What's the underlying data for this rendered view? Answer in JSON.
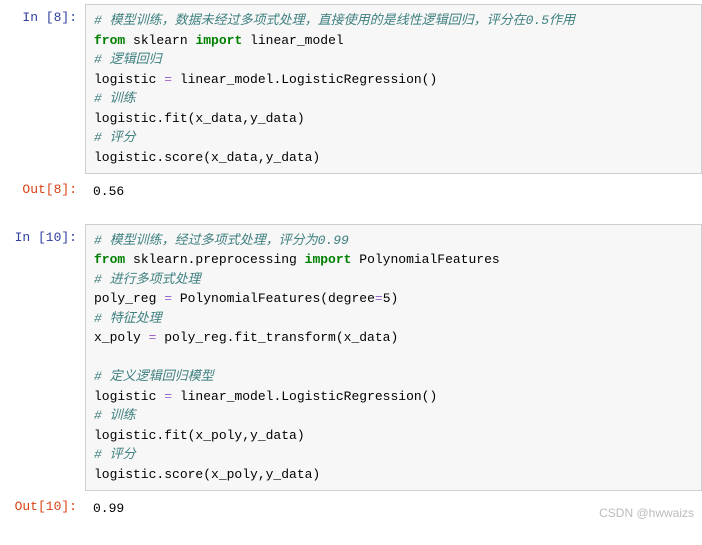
{
  "cells": [
    {
      "prompt_label": "In  [8]:",
      "type": "in",
      "lines": [
        [
          {
            "cls": "c-comment",
            "t": "# 模型训练，数据未经过多项式处理，直接使用的是线性逻辑回归，评分在0.5作用"
          }
        ],
        [
          {
            "cls": "c-keyword",
            "t": "from"
          },
          {
            "cls": "",
            "t": " sklearn "
          },
          {
            "cls": "c-keyword",
            "t": "import"
          },
          {
            "cls": "",
            "t": " linear_model"
          }
        ],
        [
          {
            "cls": "c-comment",
            "t": "# 逻辑回归"
          }
        ],
        [
          {
            "cls": "",
            "t": "logistic "
          },
          {
            "cls": "c-operator",
            "t": "="
          },
          {
            "cls": "",
            "t": " linear_model.LogisticRegression()"
          }
        ],
        [
          {
            "cls": "c-comment",
            "t": "# 训练"
          }
        ],
        [
          {
            "cls": "",
            "t": "logistic.fit(x_data,y_data)"
          }
        ],
        [
          {
            "cls": "c-comment",
            "t": "# 评分"
          }
        ],
        [
          {
            "cls": "",
            "t": "logistic.score(x_data,y_data)"
          }
        ]
      ]
    },
    {
      "prompt_label": "Out[8]:",
      "type": "out",
      "output": "0.56"
    },
    {
      "prompt_label": "In  [10]:",
      "type": "in",
      "lines": [
        [
          {
            "cls": "c-comment",
            "t": "# 模型训练，经过多项式处理，评分为0.99"
          }
        ],
        [
          {
            "cls": "c-keyword",
            "t": "from"
          },
          {
            "cls": "",
            "t": " sklearn.preprocessing "
          },
          {
            "cls": "c-keyword",
            "t": "import"
          },
          {
            "cls": "",
            "t": " PolynomialFeatures"
          }
        ],
        [
          {
            "cls": "c-comment",
            "t": "# 进行多项式处理"
          }
        ],
        [
          {
            "cls": "",
            "t": "poly_reg "
          },
          {
            "cls": "c-operator",
            "t": "="
          },
          {
            "cls": "",
            "t": " PolynomialFeatures(degree"
          },
          {
            "cls": "c-operator",
            "t": "="
          },
          {
            "cls": "",
            "t": "5)"
          }
        ],
        [
          {
            "cls": "c-comment",
            "t": "# 特征处理"
          }
        ],
        [
          {
            "cls": "",
            "t": "x_poly "
          },
          {
            "cls": "c-operator",
            "t": "="
          },
          {
            "cls": "",
            "t": " poly_reg.fit_transform(x_data)"
          }
        ],
        [
          {
            "cls": "",
            "t": ""
          }
        ],
        [
          {
            "cls": "c-comment",
            "t": "# 定义逻辑回归模型"
          }
        ],
        [
          {
            "cls": "",
            "t": "logistic "
          },
          {
            "cls": "c-operator",
            "t": "="
          },
          {
            "cls": "",
            "t": " linear_model.LogisticRegression()"
          }
        ],
        [
          {
            "cls": "c-comment",
            "t": "# 训练"
          }
        ],
        [
          {
            "cls": "",
            "t": "logistic.fit(x_poly,y_data)"
          }
        ],
        [
          {
            "cls": "c-comment",
            "t": "# 评分"
          }
        ],
        [
          {
            "cls": "",
            "t": "logistic.score(x_poly,y_data)"
          }
        ]
      ]
    },
    {
      "prompt_label": "Out[10]:",
      "type": "out",
      "output": "0.99"
    }
  ],
  "watermark": "CSDN @hwwaizs"
}
